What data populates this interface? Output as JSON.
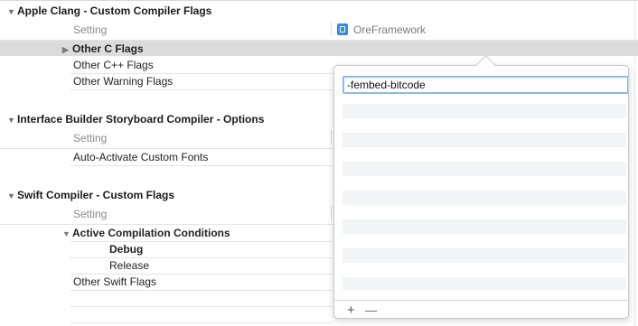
{
  "sections": [
    {
      "title": "Apple Clang - Custom Compiler Flags",
      "header_setting": "Setting",
      "header_target": "OreFramework",
      "rows": [
        "Other C Flags",
        "Other C++ Flags",
        "Other Warning Flags"
      ]
    },
    {
      "title": "Interface Builder Storyboard Compiler - Options",
      "header_setting": "Setting",
      "rows": [
        "Auto-Activate Custom Fonts"
      ]
    },
    {
      "title": "Swift Compiler - Custom Flags",
      "header_setting": "Setting",
      "rows": [
        "Active Compilation Conditions",
        "Debug",
        "Release",
        "Other Swift Flags"
      ]
    }
  ],
  "popover": {
    "value": "-fembed-bitcode",
    "add_label": "+",
    "remove_label": "—"
  }
}
